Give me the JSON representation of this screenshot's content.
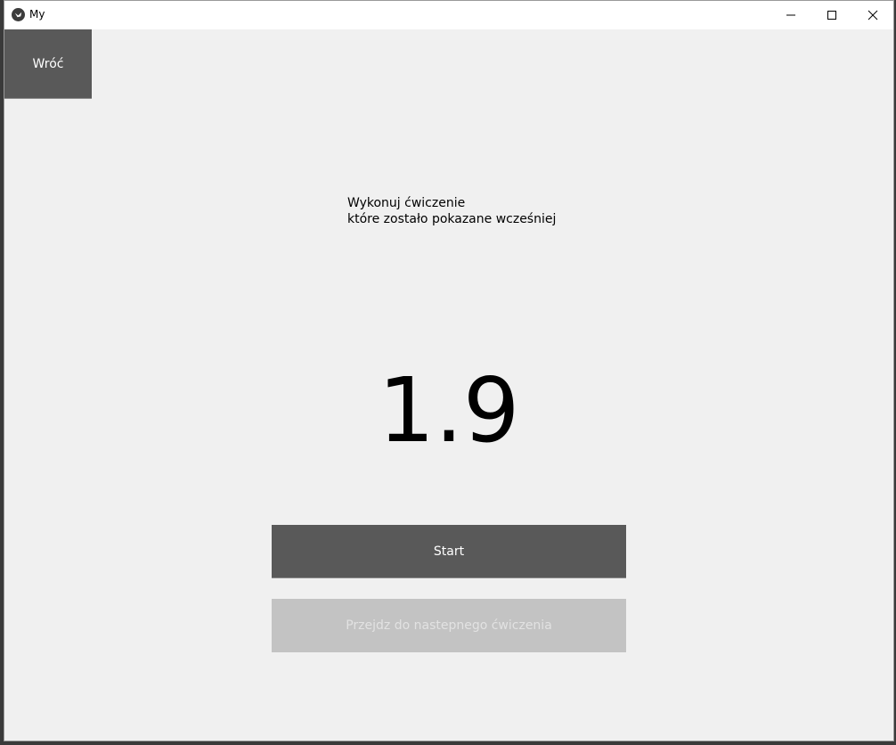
{
  "window": {
    "title": "My"
  },
  "nav": {
    "back_label": "Wróć"
  },
  "instruction": {
    "line1": "Wykonuj ćwiczenie",
    "line2": "które zostało pokazane wcześniej"
  },
  "timer": {
    "value": "1.9"
  },
  "actions": {
    "start_label": "Start",
    "next_label": "Przejdz do nastepnego ćwiczenia",
    "next_enabled": false
  },
  "icons": {
    "app": "kivy-logo-icon",
    "minimize": "minimize-icon",
    "maximize": "maximize-icon",
    "close": "close-icon"
  }
}
